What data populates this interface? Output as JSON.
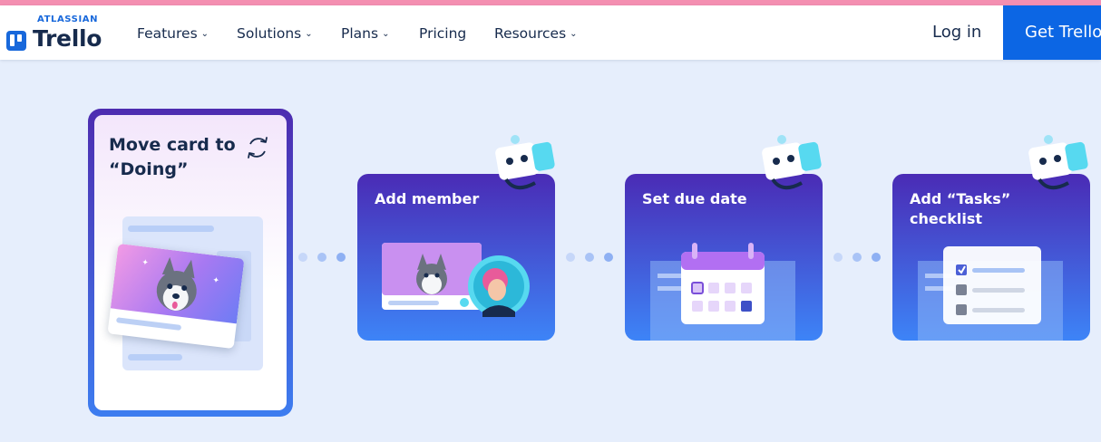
{
  "brand": {
    "company": "ATLASSIAN",
    "product": "Trello",
    "accent": "#1868db",
    "strip_color": "#f48fb1"
  },
  "nav": {
    "items": [
      {
        "label": "Features",
        "has_dropdown": true
      },
      {
        "label": "Solutions",
        "has_dropdown": true
      },
      {
        "label": "Plans",
        "has_dropdown": true
      },
      {
        "label": "Pricing",
        "has_dropdown": false
      },
      {
        "label": "Resources",
        "has_dropdown": true
      }
    ],
    "login_label": "Log in",
    "cta_label": "Get Trello"
  },
  "hero": {
    "trigger_card": {
      "title": "Move card to “Doing”",
      "icon": "sync-icon"
    },
    "steps": [
      {
        "label": "Add member",
        "illustration": "member-illustration"
      },
      {
        "label": "Set due date",
        "illustration": "calendar-illustration"
      },
      {
        "label": "Add “Tasks” checklist",
        "illustration": "checklist-illustration"
      }
    ],
    "colors": {
      "card_gradient_top": "#4a2bb5",
      "card_gradient_bottom": "#3d84f7",
      "background": "#e6eefc"
    }
  }
}
